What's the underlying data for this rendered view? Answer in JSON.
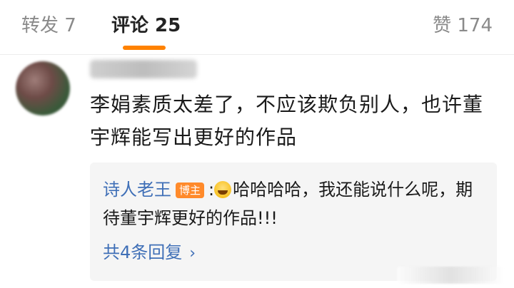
{
  "tabs": {
    "repost": "转发 7",
    "comments": "评论 25",
    "likes": "赞 174"
  },
  "comment": {
    "text": "李娟素质太差了，不应该欺负别人，也许董宇辉能写出更好的作品"
  },
  "reply": {
    "author": "诗人老王",
    "badge": "博主",
    "separator": ":",
    "emoji": "laughing-crying-emoji",
    "text": "哈哈哈哈，我还能说什么呢，期待董宇辉更好的作品!!!",
    "more": "共4条回复"
  },
  "colors": {
    "accent": "#ff8200",
    "link": "#3f6fb7",
    "badge": "#ff8a2b",
    "reply_bg": "#f5f5f5"
  }
}
